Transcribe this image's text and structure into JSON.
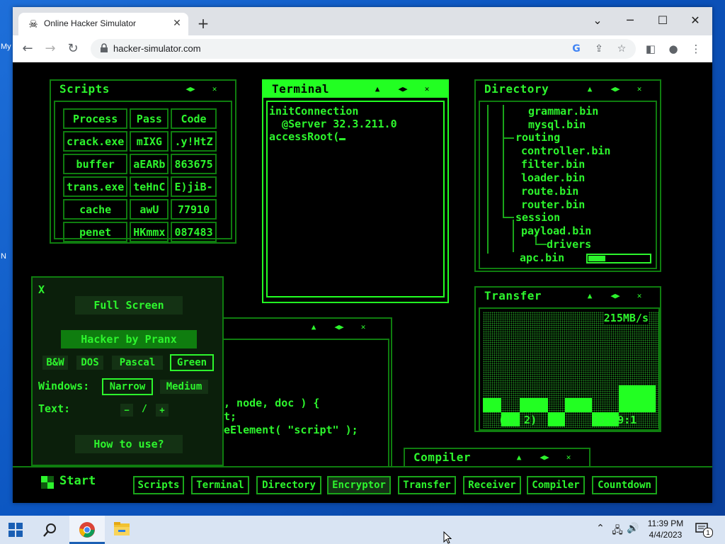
{
  "desktop": {
    "icon_labels": [
      "My",
      "N"
    ]
  },
  "browser": {
    "tab_title": "Online Hacker Simulator",
    "tab_close": "✕",
    "new_tab": "+",
    "url": "hacker-simulator.com",
    "window_controls": {
      "minimize": "⌄",
      "restore": "─",
      "maximize": "☐",
      "close": "✕"
    }
  },
  "scripts": {
    "title": "Scripts",
    "headers": [
      "Process",
      "Pass",
      "Code"
    ],
    "rows": [
      [
        "crack.exe",
        "mIXG",
        ".y!HtZ"
      ],
      [
        "buffer",
        "aEARb",
        "863675"
      ],
      [
        "trans.exe",
        "teHnC",
        "E)jiB-"
      ],
      [
        "cache",
        "awU",
        "77910"
      ],
      [
        "penet",
        "HKmmx",
        "087483"
      ]
    ]
  },
  "terminal": {
    "title": "Terminal",
    "lines": [
      "initConnection",
      "  @Server 32.3.211.0",
      "accessRoot("
    ]
  },
  "directory": {
    "title": "Directory",
    "items": [
      "grammar.bin",
      "mysql.bin",
      "routing",
      "controller.bin",
      "filter.bin",
      "loader.bin",
      "route.bin",
      "router.bin",
      "session",
      "payload.bin",
      "drivers",
      "apc.bin"
    ],
    "progress": 0.28
  },
  "transfer": {
    "title": "Transfer",
    "speed": "215MB/s",
    "coords": "(1, 2)",
    "time": "23:39:1"
  },
  "encryptor": {
    "code_lines": [
      ", node, doc ) {",
      "t;",
      "",
      "eElement( \"script\" );"
    ]
  },
  "compiler": {
    "title": "Compiler"
  },
  "window_buttons": {
    "up": "▲",
    "lr": "◀▶",
    "close": "✕"
  },
  "options": {
    "close": "X",
    "full_screen": "Full Screen",
    "brand": "Hacker by Pranx",
    "themes": [
      "B&W",
      "DOS",
      "Pascal",
      "Green"
    ],
    "selected_theme": "Green",
    "windows_label": "Windows:",
    "window_sizes": [
      "Narrow",
      "Medium"
    ],
    "text_label": "Text:",
    "text_minus": "−",
    "text_slash": "/",
    "text_plus": "+",
    "how_to": "How to use?"
  },
  "taskbar": {
    "start": "Start",
    "buttons": [
      "Scripts",
      "Terminal",
      "Directory",
      "Encryptor",
      "Transfer",
      "Receiver",
      "Compiler",
      "Countdown"
    ]
  },
  "system": {
    "time": "11:39 PM",
    "date": "4/4/2023",
    "notifications": "1"
  },
  "colors": {
    "green": "#2df52d",
    "dark_green": "#0f7d0f",
    "bright": "#22ff22"
  }
}
